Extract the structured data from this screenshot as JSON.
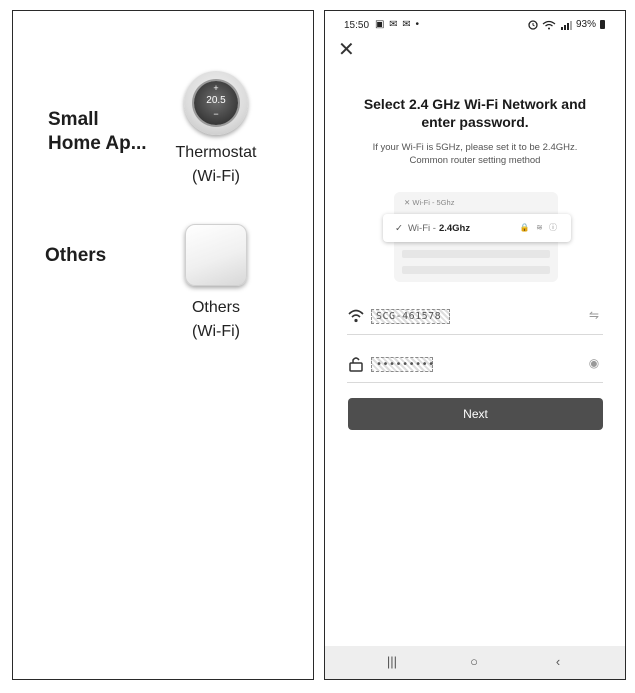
{
  "left": {
    "categories": [
      {
        "label_line1": "Small",
        "label_line2": "Home Ap..."
      },
      {
        "label": "Others"
      }
    ],
    "devices": [
      {
        "name_line1": "Thermostat",
        "name_line2": "(Wi-Fi)",
        "temp": "20.5",
        "plus": "+",
        "minus": "−"
      },
      {
        "name_line1": "Others",
        "name_line2": "(Wi-Fi)"
      }
    ]
  },
  "right": {
    "status_bar": {
      "time": "15:50",
      "left_icons": "▣ ✉ ✉ •",
      "battery": "93%"
    },
    "close_label": "✕",
    "title_line1": "Select 2.4 GHz Wi-Fi Network and",
    "title_line2": "enter password.",
    "hint_line1": "If your Wi-Fi is 5GHz, please set it to be 2.4GHz.",
    "hint_line2": "Common router setting method",
    "illustration": {
      "wifi_5g_label": "✕  Wi-Fi - 5Ghz",
      "check": "✓",
      "wifi_prefix": "Wi-Fi -",
      "wifi_24_label": "2.4Ghz",
      "row_icons": "🔒 ≋ ⓘ"
    },
    "ssid_field": {
      "value": "SCG-461578",
      "switch_icon": "⇋"
    },
    "password_field": {
      "value": "•••••••••",
      "toggle_icon": "◉"
    },
    "next_button": "Next",
    "nav": {
      "recents": "|||",
      "home": "○",
      "back": "‹"
    }
  }
}
